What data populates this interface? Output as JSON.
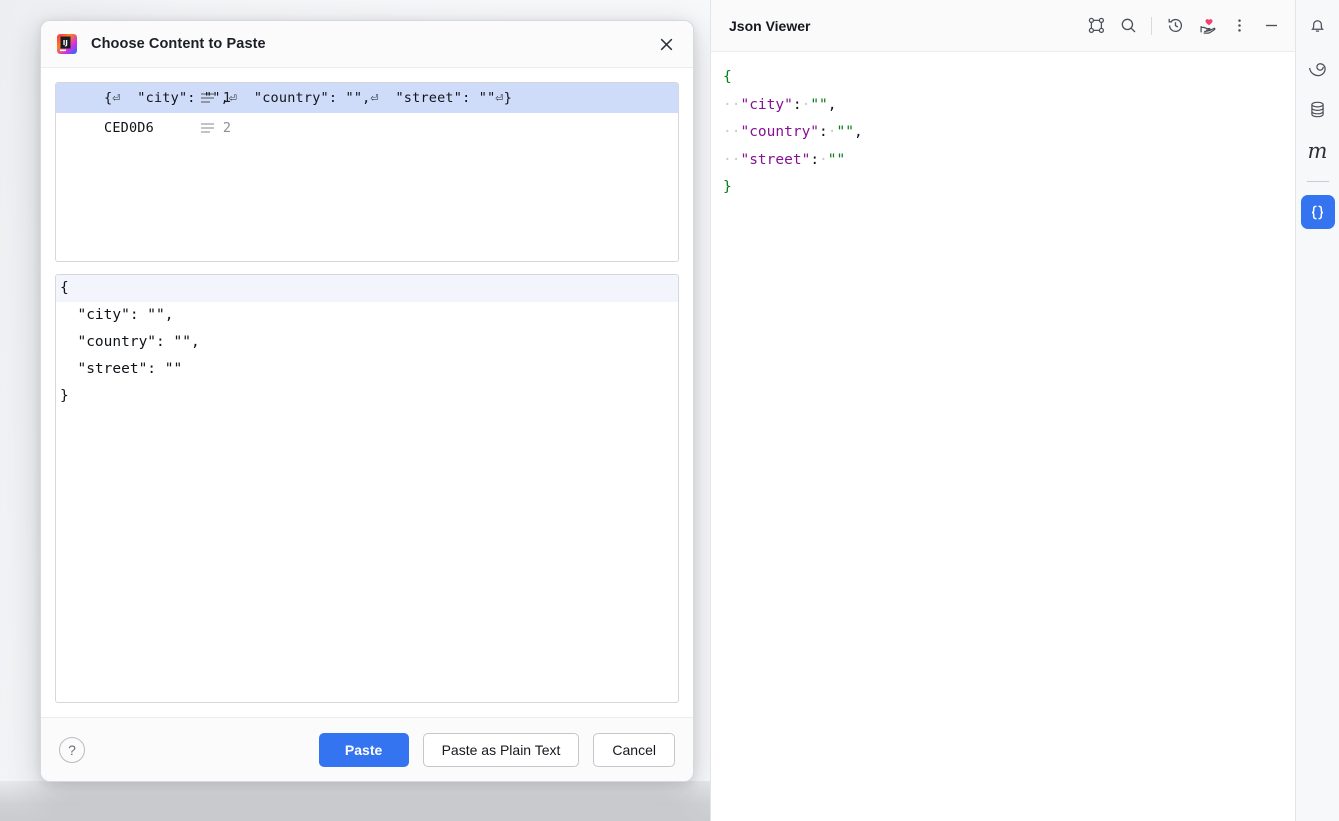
{
  "window": {
    "background_color": "#f7f8fa"
  },
  "dialog": {
    "title": "Choose Content to Paste",
    "app_icon": "intellij-idea-icon",
    "close_icon": "close-icon",
    "clipboard_entries": [
      {
        "index": "1",
        "text": "{⏎  \"city\": \"\",⏎  \"country\": \"\",⏎  \"street\": \"\"⏎}",
        "selected": true
      },
      {
        "index": "2",
        "text": "CED0D6",
        "selected": false
      }
    ],
    "preview_lines": [
      "{",
      "  \"city\": \"\",",
      "  \"country\": \"\",",
      "  \"street\": \"\"",
      "}"
    ],
    "footer": {
      "help_label": "?",
      "paste_label": "Paste",
      "paste_plain_label": "Paste as Plain Text",
      "cancel_label": "Cancel",
      "primary_color": "#3574f0"
    }
  },
  "viewer": {
    "title": "Json Viewer",
    "tools": [
      {
        "name": "structure-graph-icon"
      },
      {
        "name": "search-icon"
      },
      {
        "name": "history-icon"
      },
      {
        "name": "donate-heart-hand-icon"
      },
      {
        "name": "more-options-icon"
      },
      {
        "name": "minimize-icon"
      }
    ],
    "json_lines": [
      {
        "indent": 0,
        "tokens": [
          {
            "type": "brace",
            "text": "{"
          }
        ]
      },
      {
        "indent": 2,
        "tokens": [
          {
            "type": "key",
            "text": "\"city\""
          },
          {
            "type": "punc",
            "text": ":"
          },
          {
            "type": "ws",
            "text": "·"
          },
          {
            "type": "str",
            "text": "\"\""
          },
          {
            "type": "punc",
            "text": ","
          }
        ]
      },
      {
        "indent": 2,
        "tokens": [
          {
            "type": "key",
            "text": "\"country\""
          },
          {
            "type": "punc",
            "text": ":"
          },
          {
            "type": "ws",
            "text": "·"
          },
          {
            "type": "str",
            "text": "\"\""
          },
          {
            "type": "punc",
            "text": ","
          }
        ]
      },
      {
        "indent": 2,
        "tokens": [
          {
            "type": "key",
            "text": "\"street\""
          },
          {
            "type": "punc",
            "text": ":"
          },
          {
            "type": "ws",
            "text": "·"
          },
          {
            "type": "str",
            "text": "\"\""
          }
        ]
      },
      {
        "indent": 0,
        "tokens": [
          {
            "type": "brace",
            "text": "}"
          }
        ]
      }
    ]
  },
  "rail": {
    "items": [
      {
        "name": "notifications-bell-icon",
        "selected": false
      },
      {
        "name": "spiral-icon",
        "selected": false
      },
      {
        "name": "database-icon",
        "selected": false
      },
      {
        "name": "m-letter-icon",
        "label": "m",
        "selected": false
      }
    ],
    "selected_item": {
      "name": "json-braces-icon",
      "label": "{}",
      "selected": true,
      "color": "#3574f0"
    }
  }
}
